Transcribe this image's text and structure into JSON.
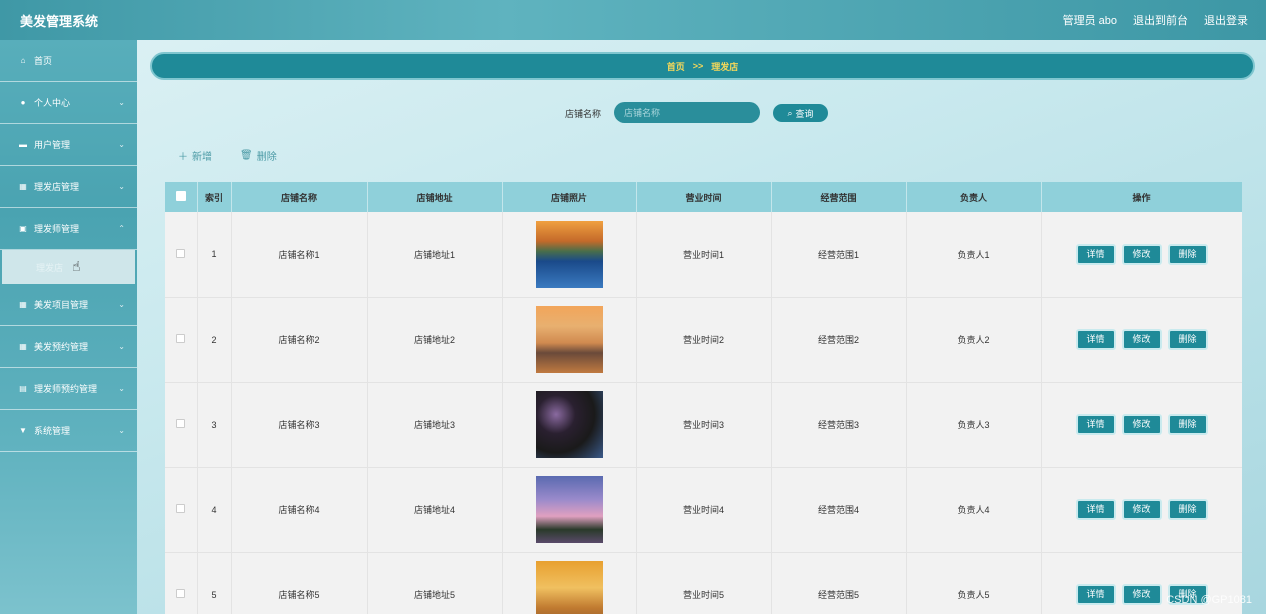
{
  "header": {
    "title": "美发管理系统",
    "user": "管理员 abo",
    "back_front": "退出到前台",
    "logout": "退出登录"
  },
  "sidebar": {
    "items": [
      {
        "label": "首页",
        "icon": "home-icon"
      },
      {
        "label": "个人中心",
        "icon": "user-icon"
      },
      {
        "label": "用户管理",
        "icon": "monitor-icon"
      },
      {
        "label": "理发店管理",
        "icon": "grid-icon"
      },
      {
        "label": "理发师管理",
        "icon": "briefcase-icon"
      },
      {
        "label": "美发项目管理",
        "icon": "grid-icon"
      },
      {
        "label": "美发预约管理",
        "icon": "grid-icon"
      },
      {
        "label": "理发师预约管理",
        "icon": "clipboard-icon"
      },
      {
        "label": "系统管理",
        "icon": "settings-icon"
      }
    ],
    "submenu_label": "理发店"
  },
  "breadcrumb": {
    "home": "首页",
    "sep": ">>",
    "current": "理发店"
  },
  "search": {
    "label": "店铺名称",
    "placeholder": "店铺名称",
    "button": "查询"
  },
  "actions": {
    "add": "新增",
    "delete": "删除"
  },
  "table": {
    "columns": [
      "索引",
      "店铺名称",
      "店铺地址",
      "店铺照片",
      "营业时间",
      "经营范围",
      "负责人",
      "操作"
    ],
    "rows": [
      {
        "index": "1",
        "name": "店铺名称1",
        "address": "店铺地址1",
        "hours": "营业时间1",
        "scope": "经营范围1",
        "owner": "负责人1"
      },
      {
        "index": "2",
        "name": "店铺名称2",
        "address": "店铺地址2",
        "hours": "营业时间2",
        "scope": "经营范围2",
        "owner": "负责人2"
      },
      {
        "index": "3",
        "name": "店铺名称3",
        "address": "店铺地址3",
        "hours": "营业时间3",
        "scope": "经营范围3",
        "owner": "负责人3"
      },
      {
        "index": "4",
        "name": "店铺名称4",
        "address": "店铺地址4",
        "hours": "营业时间4",
        "scope": "经营范围4",
        "owner": "负责人4"
      },
      {
        "index": "5",
        "name": "店铺名称5",
        "address": "店铺地址5",
        "hours": "营业时间5",
        "scope": "经营范围5",
        "owner": "负责人5"
      }
    ],
    "row_buttons": {
      "detail": "详情",
      "edit": "修改",
      "delete": "删除"
    }
  },
  "watermark": "CSDN @GP1081",
  "colors": {
    "accent": "#1f8a98",
    "header_bg": "#8fd0da",
    "breadcrumb_text": "#f5d85a"
  }
}
